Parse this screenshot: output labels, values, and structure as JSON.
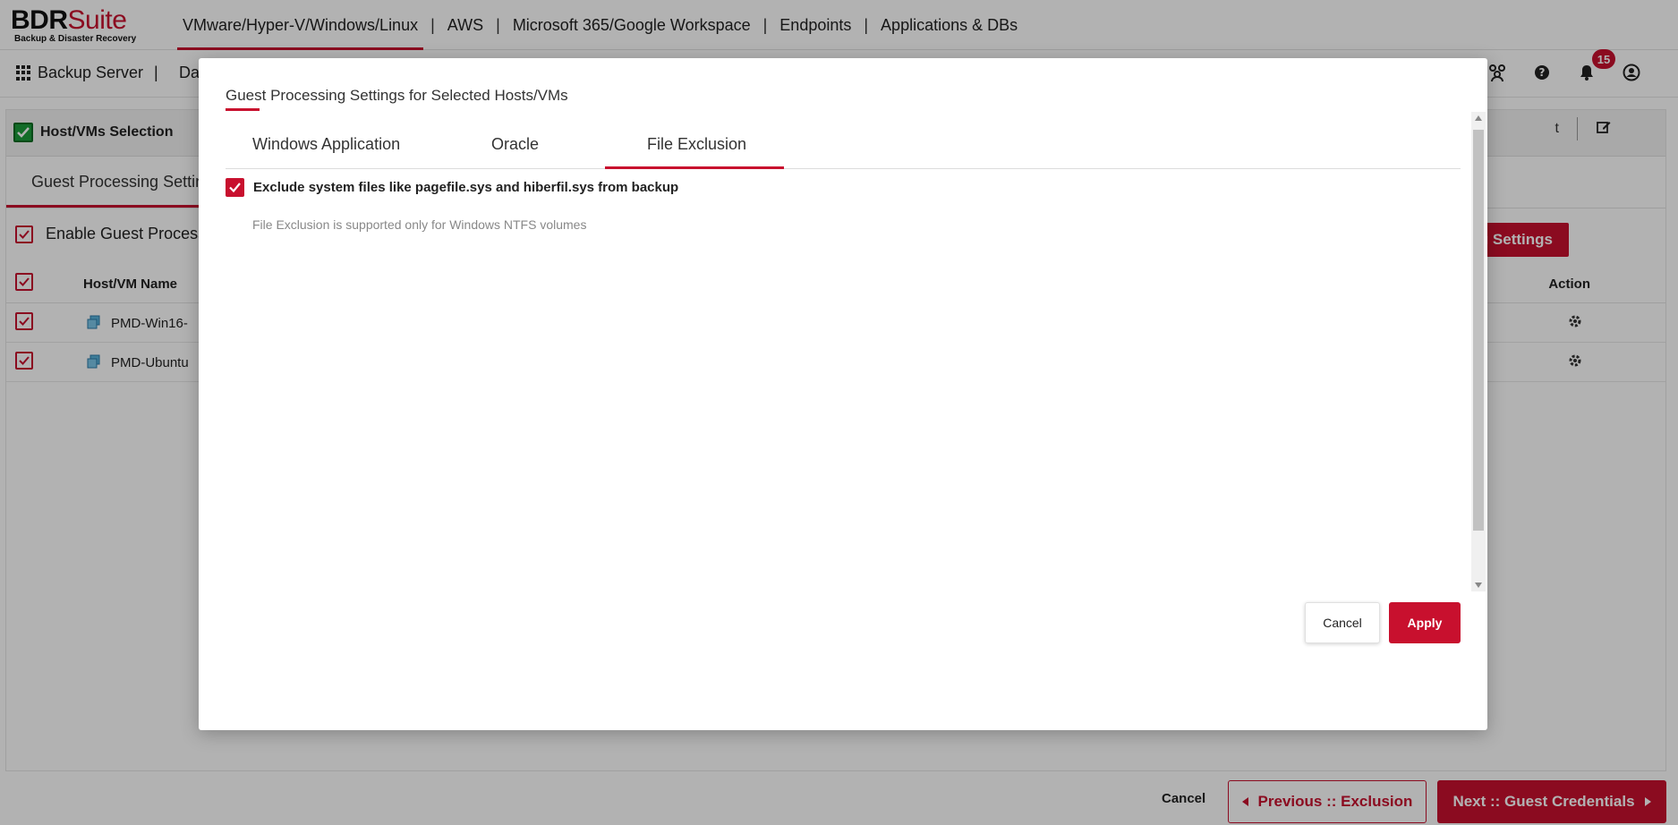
{
  "app": {
    "brand_main": "BDR",
    "brand_suite": "Suite",
    "brand_tagline": "Backup & Disaster Recovery"
  },
  "topnav": {
    "items": [
      {
        "label": "VMware/Hyper-V/Windows/Linux",
        "active": true
      },
      {
        "label": "AWS"
      },
      {
        "label": "Microsoft 365/Google Workspace"
      },
      {
        "label": "Endpoints"
      },
      {
        "label": "Applications & DBs"
      }
    ],
    "separator": "|"
  },
  "subnav": {
    "server_label": "Backup Server",
    "separator": "|",
    "partial_item": "Da",
    "notification_count": "15"
  },
  "wizard": {
    "step1_label": "Host/VMs Selection",
    "step_right_partial": "t",
    "tab_label": "Guest Processing Settings",
    "enable_label": "Enable Guest Processing",
    "settings_button": "g Settings",
    "table": {
      "col_name": "Host/VM Name",
      "col_action": "Action",
      "rows": [
        {
          "name": "PMD-Win16-"
        },
        {
          "name": "PMD-Ubuntu"
        }
      ]
    }
  },
  "footer": {
    "cancel": "Cancel",
    "previous": "Previous :: Exclusion",
    "next": "Next :: Guest Credentials"
  },
  "modal": {
    "title": "Guest Processing Settings for Selected Hosts/VMs",
    "tabs": [
      {
        "label": "Windows Application"
      },
      {
        "label": "Oracle"
      },
      {
        "label": "File Exclusion",
        "active": true
      }
    ],
    "option_label": "Exclude system files like pagefile.sys and hiberfil.sys from backup",
    "option_checked": true,
    "note": "File Exclusion is supported only for Windows NTFS volumes",
    "cancel": "Cancel",
    "apply": "Apply"
  },
  "colors": {
    "accent": "#c8102e",
    "success": "#1a9b3a"
  }
}
